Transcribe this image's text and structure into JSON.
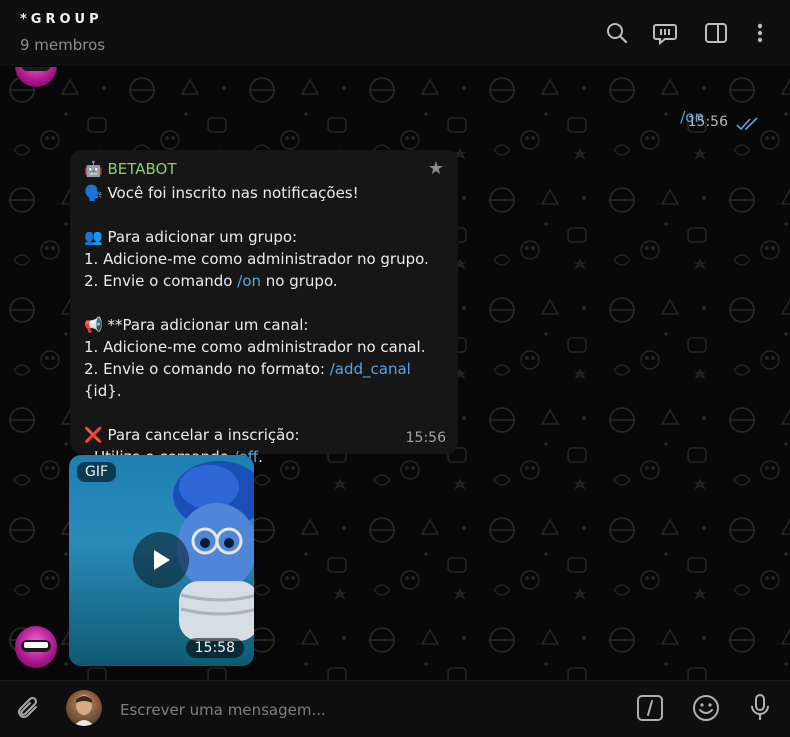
{
  "header": {
    "title": "*GROUP",
    "subtitle": "9 membros",
    "icons": [
      "search-icon",
      "topics-icon",
      "sidebar-toggle-icon",
      "more-vertical-icon"
    ]
  },
  "outgoing": {
    "text": "/on",
    "time": "15:56",
    "status": "read"
  },
  "bot_message": {
    "sender": "BETABOT",
    "sender_emoji": "🤖",
    "pinned_icon": "★",
    "line1": "🗣️ Você foi inscrito nas notificações!",
    "group_heading": "👥 Para adicionar um grupo:",
    "group_step1": "1. Adicione-me como administrador no grupo.",
    "group_step2_pre": "2. Envie o comando ",
    "group_step2_cmd": "/on",
    "group_step2_post": " no grupo.",
    "channel_heading": "📢 **Para adicionar um canal:",
    "channel_step1": "1. Adicione-me como administrador no canal.",
    "channel_step2_pre": "2. Envie o comando no formato: ",
    "channel_step2_cmd": "/add_canal",
    "channel_step2_post": " {id}.",
    "cancel_heading": "❌ Para cancelar a inscrição:",
    "cancel_pre": "- Utilize o comando ",
    "cancel_cmd": "/off",
    "cancel_post": ".",
    "time": "15:56"
  },
  "gif_message": {
    "tag": "GIF",
    "time": "15:58"
  },
  "composer": {
    "placeholder": "Escrever uma mensagem...",
    "icons": [
      "attach-icon",
      "commands-icon",
      "emoji-icon",
      "microphone-icon"
    ]
  },
  "colors": {
    "link": "#5aa4e6",
    "sender": "#8bd06a",
    "background": "#080808",
    "bubble": "#161616"
  }
}
